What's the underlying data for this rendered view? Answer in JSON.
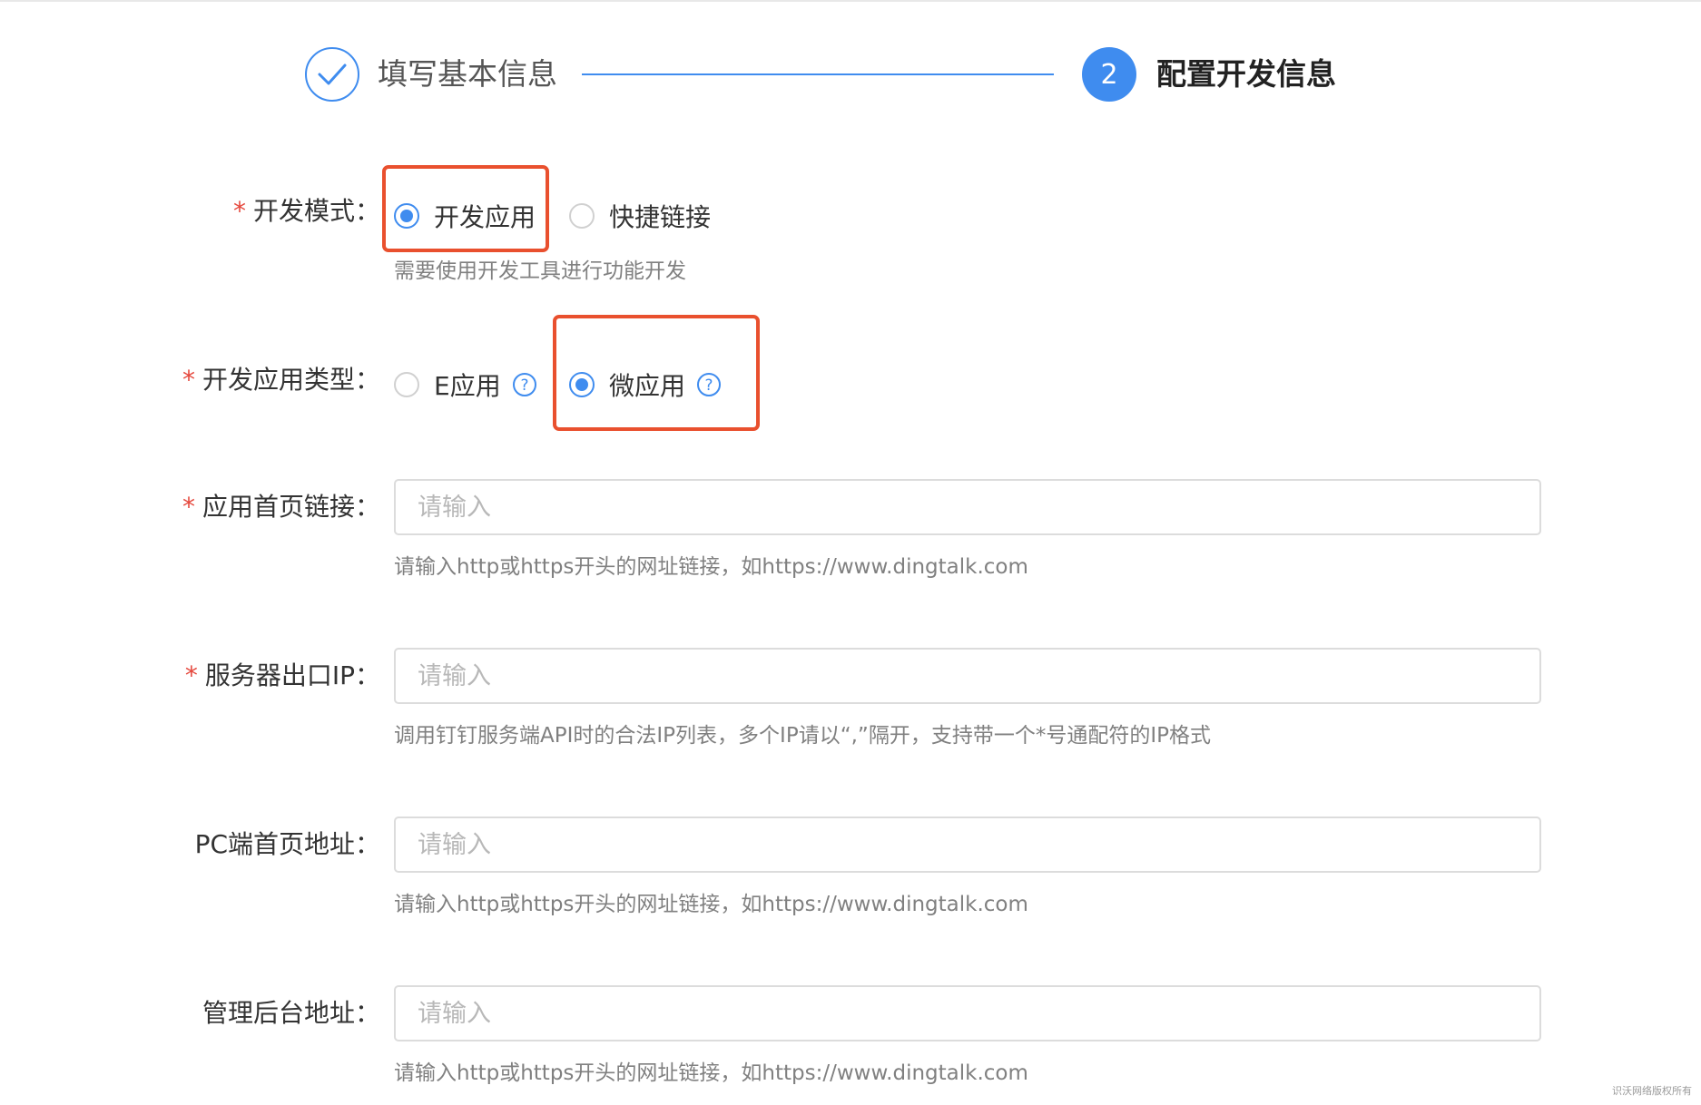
{
  "steps": [
    {
      "label": "填写基本信息",
      "status": "done",
      "icon": "check-icon"
    },
    {
      "number": "2",
      "label": "配置开发信息",
      "status": "active"
    }
  ],
  "colors": {
    "accent": "#3f8cef",
    "required": "#e5483d",
    "highlight": "#e9502e"
  },
  "form": {
    "dev_mode": {
      "required_mark": "*",
      "label": "开发模式：",
      "options": [
        {
          "label": "开发应用",
          "checked": true
        },
        {
          "label": "快捷链接",
          "checked": false
        }
      ],
      "hint": "需要使用开发工具进行功能开发"
    },
    "app_type": {
      "required_mark": "*",
      "label": "开发应用类型：",
      "options": [
        {
          "label": "E应用",
          "checked": false
        },
        {
          "label": "微应用",
          "checked": true
        }
      ]
    },
    "home_url": {
      "required_mark": "*",
      "label": "应用首页链接：",
      "placeholder": "请输入",
      "value": "",
      "hint": "请输入http或https开头的网址链接，如https://www.dingtalk.com"
    },
    "server_ip": {
      "required_mark": "*",
      "label": "服务器出口IP：",
      "placeholder": "请输入",
      "value": "",
      "hint": "调用钉钉服务端API时的合法IP列表，多个IP请以“,”隔开，支持带一个*号通配符的IP格式"
    },
    "pc_url": {
      "label": "PC端首页地址：",
      "placeholder": "请输入",
      "value": "",
      "hint": "请输入http或https开头的网址链接，如https://www.dingtalk.com"
    },
    "admin_url": {
      "label": "管理后台地址：",
      "placeholder": "请输入",
      "value": "",
      "hint": "请输入http或https开头的网址链接，如https://www.dingtalk.com"
    }
  },
  "watermark": "识沃网络版权所有"
}
